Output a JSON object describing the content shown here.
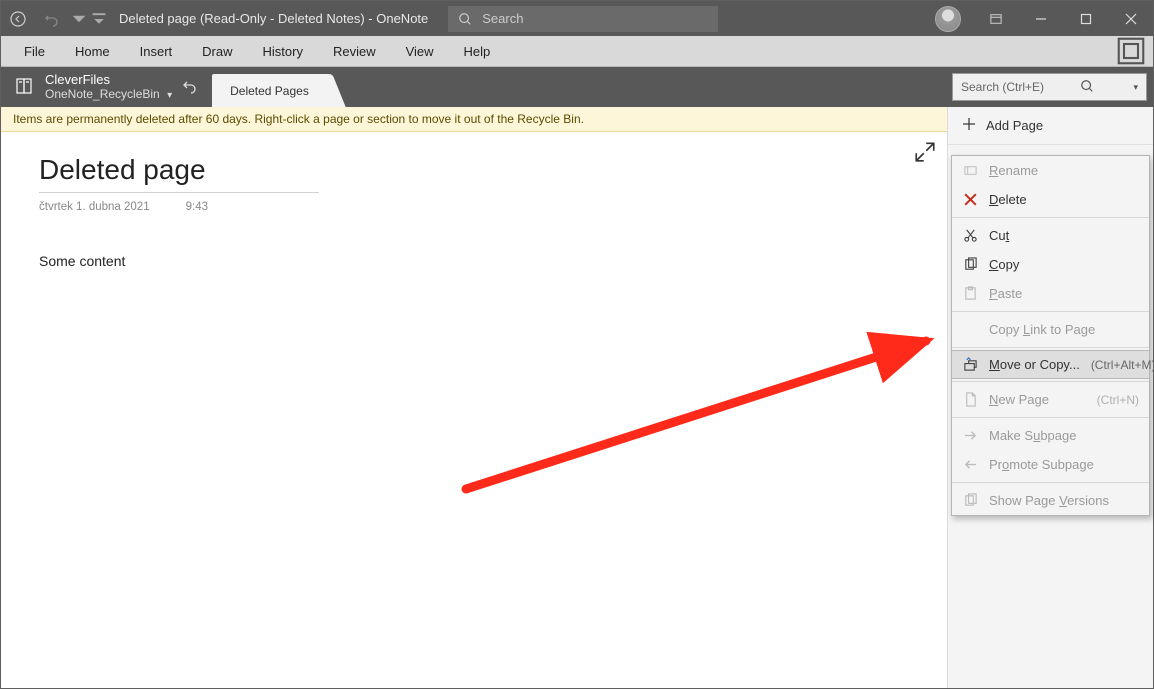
{
  "titleBar": {
    "title": "Deleted page (Read-Only - Deleted Notes)  -  OneNote",
    "searchPlaceholder": "Search"
  },
  "menu": {
    "items": [
      "File",
      "Home",
      "Insert",
      "Draw",
      "History",
      "Review",
      "View",
      "Help"
    ]
  },
  "notebook": {
    "name": "CleverFiles",
    "section": "OneNote_RecycleBin",
    "tab": "Deleted Pages"
  },
  "sideSearchPlaceholder": "Search (Ctrl+E)",
  "infoBar": "Items are permanently deleted after 60 days. Right-click a page or section to move it out of the Recycle Bin.",
  "page": {
    "title": "Deleted page",
    "date": "čtvrtek 1. dubna 2021",
    "time": "9:43",
    "content": "Some content"
  },
  "addPage": "Add Page",
  "contextMenu": {
    "rename": "Rename",
    "delete": "Delete",
    "cut": "Cut",
    "copy": "Copy",
    "paste": "Paste",
    "copyLink": "Copy Link to Page",
    "moveCopy": "Move or Copy...",
    "moveCopyShortcut": "(Ctrl+Alt+M)",
    "newPage": "New Page",
    "newPageShortcut": "(Ctrl+N)",
    "makeSub": "Make Subpage",
    "promoteSub": "Promote Subpage",
    "showVersions": "Show Page Versions"
  }
}
